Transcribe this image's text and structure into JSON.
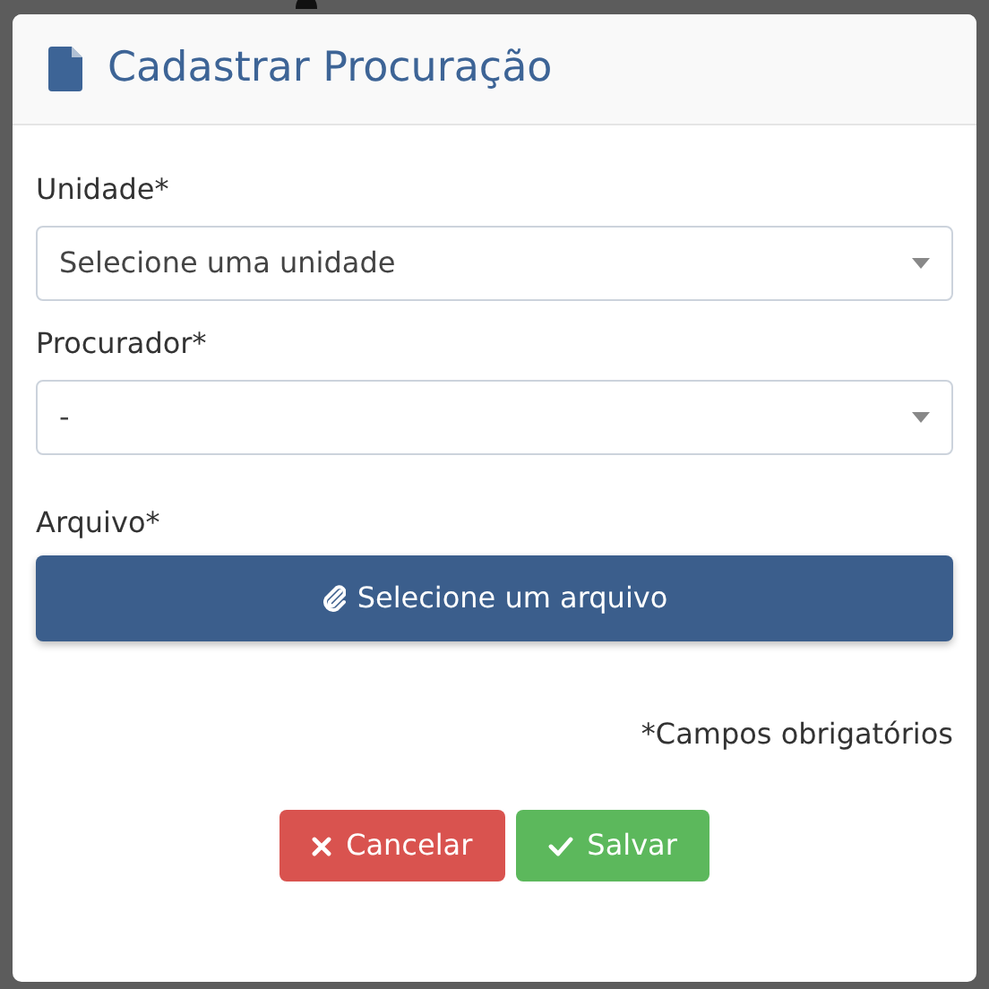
{
  "dialog": {
    "title": "Cadastrar Procuração",
    "fields": [
      {
        "kind": "select",
        "label": "Unidade*",
        "value": "Selecione uma unidade"
      },
      {
        "kind": "select",
        "label": "Procurador*",
        "value": "-"
      },
      {
        "kind": "file",
        "label": "Arquivo*",
        "button": "Selecione um arquivo"
      }
    ],
    "note": "*Campos obrigatórios",
    "buttons": [
      {
        "kind": "cancel",
        "label": "Cancelar"
      },
      {
        "kind": "save",
        "label": "Salvar"
      }
    ]
  }
}
